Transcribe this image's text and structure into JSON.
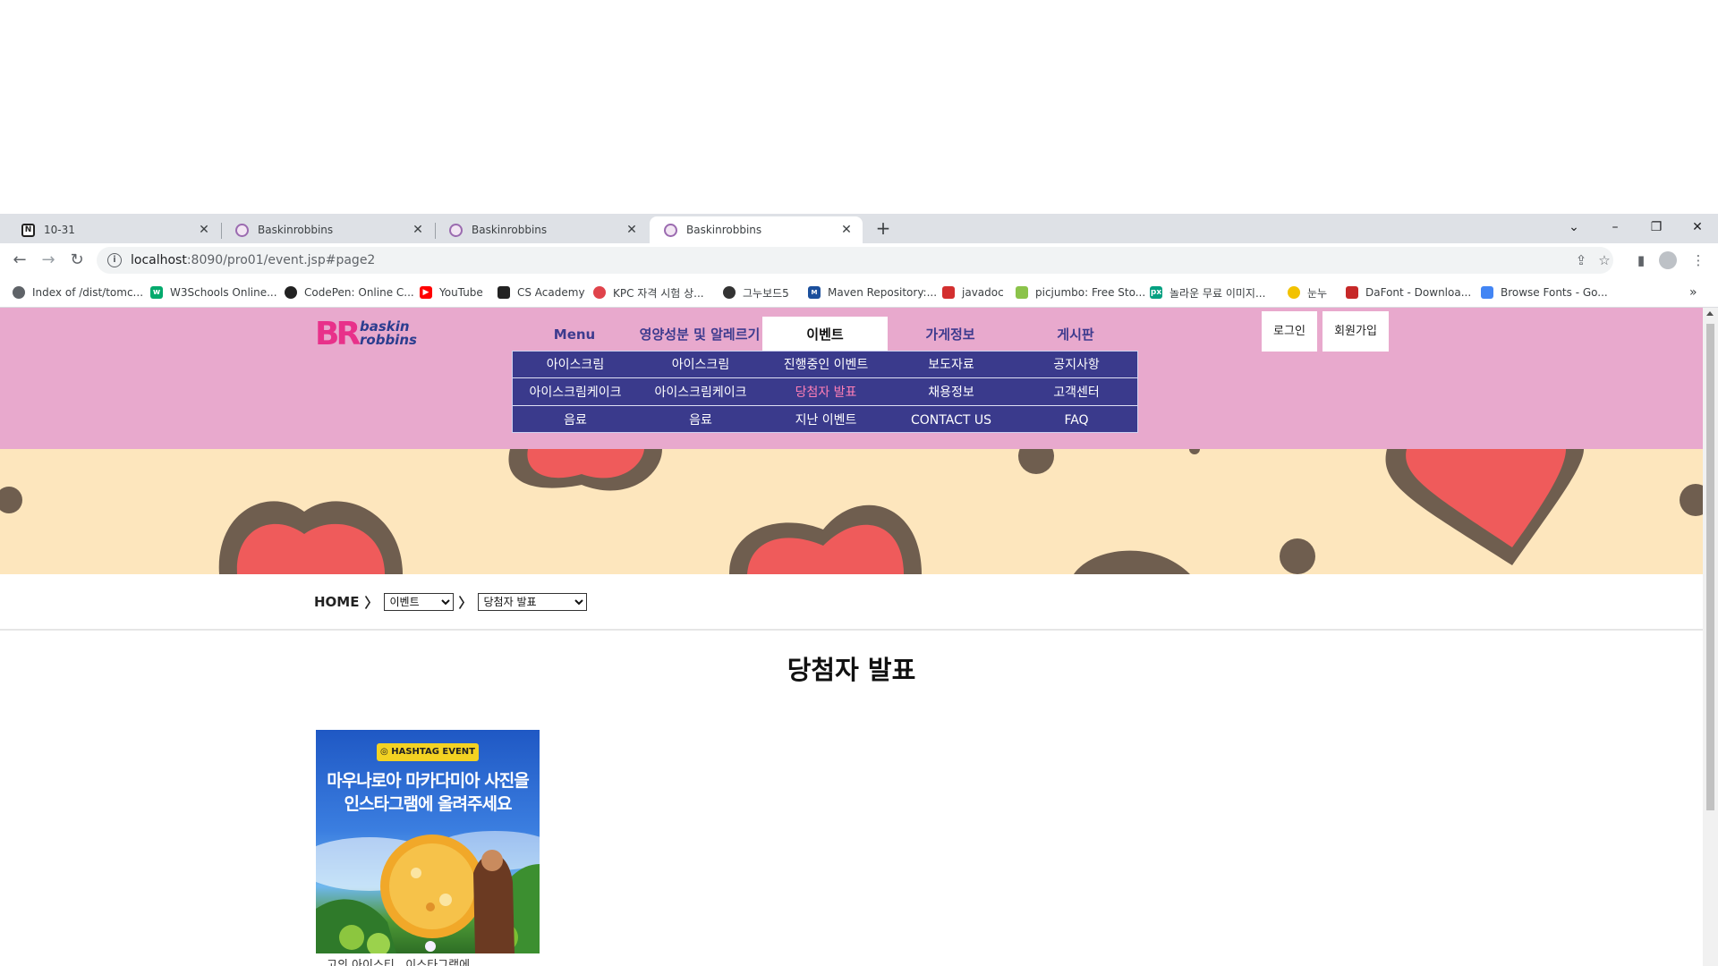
{
  "browser": {
    "tabs": [
      {
        "title": "10-31"
      },
      {
        "title": "Baskinrobbins"
      },
      {
        "title": "Baskinrobbins"
      },
      {
        "title": "Baskinrobbins"
      }
    ],
    "url_host": "localhost",
    "url_path": ":8090/pro01/event.jsp#page2",
    "bookmarks": [
      {
        "label": "Index of /dist/tomc...",
        "color": "#5f6368"
      },
      {
        "label": "W3Schools Online...",
        "color": "#04aa6d"
      },
      {
        "label": "CodePen: Online C...",
        "color": "#222222"
      },
      {
        "label": "YouTube",
        "color": "#ff0000"
      },
      {
        "label": "CS Academy",
        "color": "#222222"
      },
      {
        "label": "KPC 자격 시험 상...",
        "color": "#e0434b"
      },
      {
        "label": "그누보드5",
        "color": "#333333"
      },
      {
        "label": "Maven Repository:...",
        "color": "#1b4f9c"
      },
      {
        "label": "javadoc",
        "color": "#d32f2f"
      },
      {
        "label": "picjumbo: Free Sto...",
        "color": "#8bc34a"
      },
      {
        "label": "놀라운 무료 이미지...",
        "color": "#05a081"
      },
      {
        "label": "눈누",
        "color": "#f2c200"
      },
      {
        "label": "DaFont - Downloa...",
        "color": "#c62828"
      },
      {
        "label": "Browse Fonts - Go...",
        "color": "#4285f4"
      }
    ]
  },
  "site": {
    "logo_br": "BR",
    "logo_line1": "baskin",
    "logo_line2": "robbins",
    "nav": [
      {
        "label": "Menu"
      },
      {
        "label": "영양성분 및 알레르기"
      },
      {
        "label": "이벤트"
      },
      {
        "label": "가게정보"
      },
      {
        "label": "게시판"
      }
    ],
    "submenu_rows": [
      [
        "아이스크림",
        "아이스크림",
        "진행중인 이벤트",
        "보도자료",
        "공지사항"
      ],
      [
        "아이스크림케이크",
        "아이스크림케이크",
        "당첨자 발표",
        "채용정보",
        "고객센터"
      ],
      [
        "음료",
        "음료",
        "지난 이벤트",
        "CONTACT US",
        "FAQ"
      ]
    ],
    "login_label": "로그인",
    "signup_label": "회원가입",
    "breadcrumb": {
      "home": "HOME",
      "sep": "〉",
      "select1": "이벤트",
      "select2": "당첨자 발표"
    },
    "page_title": "당첨자 발표",
    "event_card": {
      "tag": "HASHTAG EVENT",
      "headline_line1": "마우나로아 마카다미아 사진을",
      "headline_line2": "인스타그램에 올려주세요",
      "caption": "고의 아이스티 . 이스타그램에"
    }
  }
}
